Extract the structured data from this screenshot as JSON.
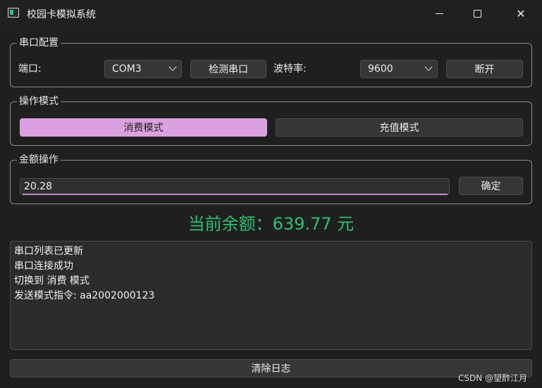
{
  "window": {
    "title": "校园卡模拟系统",
    "icon": "app-window-icon"
  },
  "serial": {
    "group_title": "串口配置",
    "port_label": "端口:",
    "port_value": "COM3",
    "detect_button": "检测串口",
    "baud_label": "波特率:",
    "baud_value": "9600",
    "disconnect_button": "断开"
  },
  "mode": {
    "group_title": "操作模式",
    "consume_button": "消费模式",
    "recharge_button": "充值模式",
    "active": "consume",
    "active_color": "#dba0df"
  },
  "amount": {
    "group_title": "金额操作",
    "input_value": "20.28",
    "confirm_button": "确定"
  },
  "balance": {
    "text": "当前余额：639.77 元",
    "color": "#2fbf71"
  },
  "log": {
    "lines": [
      "串口列表已更新",
      "串口连接成功",
      "切换到 消费 模式",
      "发送模式指令: aa2002000123"
    ]
  },
  "clear_log_button": "清除日志",
  "watermark": "CSDN @望酢江月"
}
